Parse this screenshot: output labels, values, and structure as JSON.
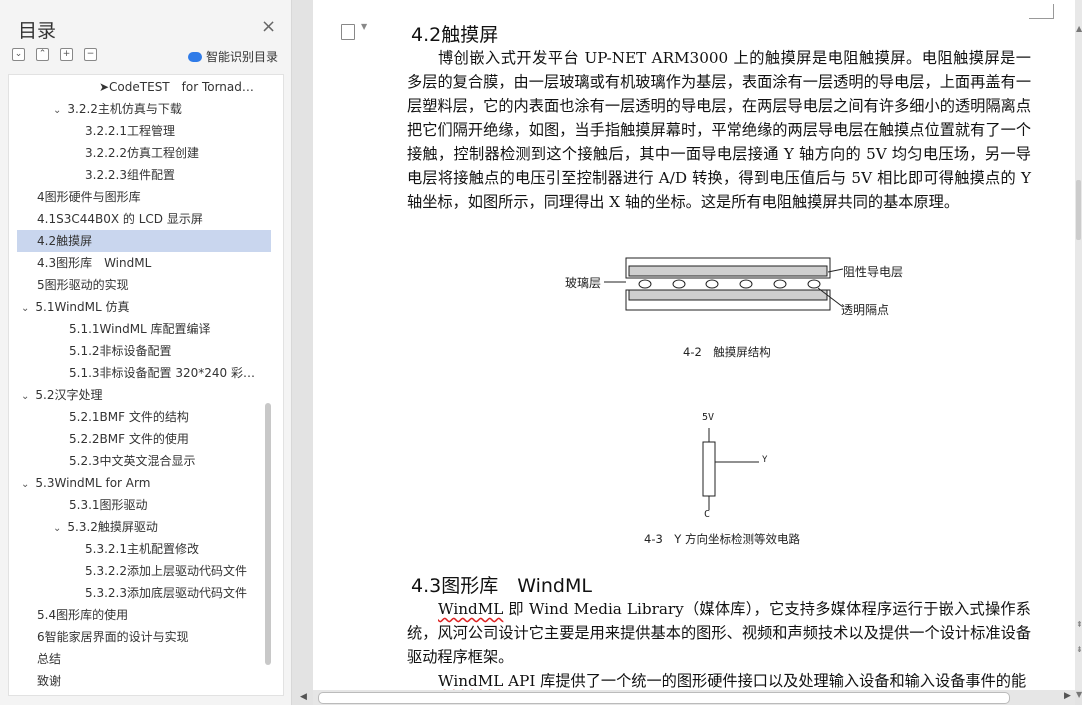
{
  "sidebar": {
    "title": "目录",
    "close": "×",
    "tools": [
      "⌄",
      "⌃",
      "+",
      "−"
    ],
    "smart_label": "智能识别目录",
    "items": [
      {
        "label": "➤CodeTEST　for Tornad…",
        "caret": ""
      },
      {
        "label": "3.2.2主机仿真与下载",
        "caret": "⌄"
      },
      {
        "label": "3.2.2.1工程管理",
        "caret": ""
      },
      {
        "label": "3.2.2.2仿真工程创建",
        "caret": ""
      },
      {
        "label": "3.2.2.3组件配置",
        "caret": ""
      },
      {
        "label": "4图形硬件与图形库",
        "caret": ""
      },
      {
        "label": "4.1S3C44B0X 的 LCD 显示屏",
        "caret": ""
      },
      {
        "label": "4.2触摸屏",
        "caret": ""
      },
      {
        "label": "4.3图形库　WindML",
        "caret": ""
      },
      {
        "label": "5图形驱动的实现",
        "caret": ""
      },
      {
        "label": "5.1WindML 仿真",
        "caret": "⌄"
      },
      {
        "label": "5.1.1WindML 库配置编译",
        "caret": ""
      },
      {
        "label": "5.1.2非标设备配置",
        "caret": ""
      },
      {
        "label": "5.1.3非标设备配置 320*240 彩…",
        "caret": ""
      },
      {
        "label": "5.2汉字处理",
        "caret": "⌄"
      },
      {
        "label": "5.2.1BMF 文件的结构",
        "caret": ""
      },
      {
        "label": "5.2.2BMF 文件的使用",
        "caret": ""
      },
      {
        "label": "5.2.3中文英文混合显示",
        "caret": ""
      },
      {
        "label": "5.3WindML for Arm",
        "caret": "⌄"
      },
      {
        "label": "5.3.1图形驱动",
        "caret": ""
      },
      {
        "label": "5.3.2触摸屏驱动",
        "caret": "⌄"
      },
      {
        "label": "5.3.2.1主机配置修改",
        "caret": ""
      },
      {
        "label": "5.3.2.2添加上层驱动代码文件",
        "caret": ""
      },
      {
        "label": "5.3.2.3添加底层驱动代码文件",
        "caret": ""
      },
      {
        "label": "5.4图形库的使用",
        "caret": ""
      },
      {
        "label": "6智能家居界面的设计与实现",
        "caret": ""
      },
      {
        "label": "总结",
        "caret": ""
      },
      {
        "label": "致谢",
        "caret": ""
      }
    ]
  },
  "doc": {
    "h_42": "4.2触摸屏",
    "p_42": "博创嵌入式开发平台 UP-NET ARM3000 上的触摸屏是电阻触摸屏。电阻触摸屏是一多层的复合膜，由一层玻璃或有机玻璃作为基层，表面涂有一层透明的导电层，上面再盖有一层塑料层，它的内表面也涂有一层透明的导电层，在两层导电层之间有许多细小的透明隔离点把它们隔开绝缘，如图，当手指触摸屏幕时，平常绝缘的两层导电层在触摸点位置就有了一个接触，控制器检测到这个接触后，其中一面导电层接通 Y 轴方向的 5V 均匀电压场，另一导电层将接触点的电压引至控制器进行 A/D 转换，得到电压值后与 5V 相比即可得触摸点的 Y 轴坐标，如图所示，同理得出 X 轴的坐标。这是所有电阻触摸屏共同的基本原理。",
    "fig1": {
      "glass": "玻璃层",
      "resist": "阻性导电层",
      "spacer": "透明隔点",
      "caption": "4-2　触摸屏结构"
    },
    "fig2": {
      "top": "5V",
      "out": "Y",
      "bottom": "C",
      "caption": "4-3　Y 方向坐标检测等效电路"
    },
    "h_43": "4.3图形库　WindML",
    "p_43a_u": "WindML",
    "p_43a": " 即 Wind Media Library（媒体库），它支持多媒体程序运行于嵌入式操作系统，风河公司设计它主要是用来提供基本的图形、视频和声频技术以及提供一个设计标准设备驱动程序框架。",
    "p_43b_u": "WindML",
    "p_43b": " API 库提供了一个统一的图形硬件接口以及处理输入设备和输入设备事件的能"
  }
}
